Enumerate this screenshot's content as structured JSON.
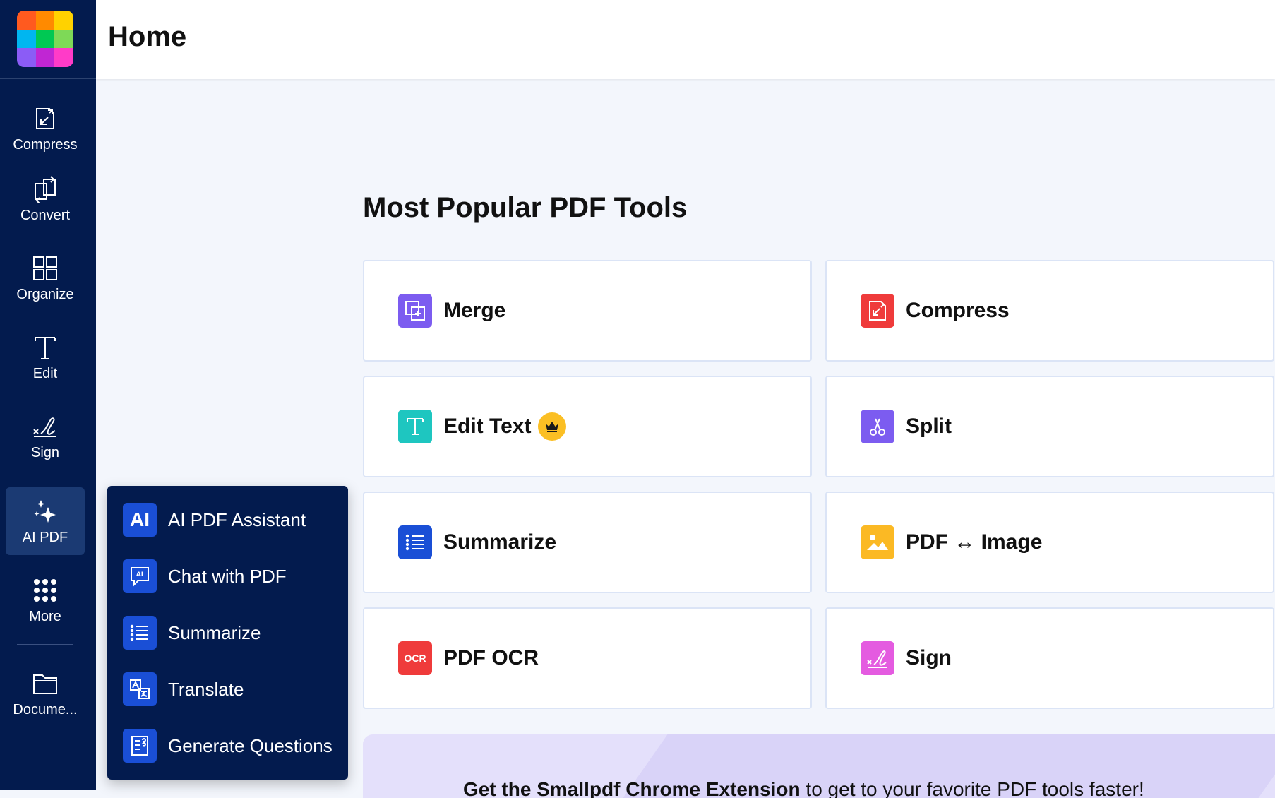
{
  "header": {
    "title": "Home"
  },
  "logo_colors": [
    "#ff5a1f",
    "#ff8a00",
    "#ffd200",
    "#00b6f0",
    "#00c853",
    "#7ed957",
    "#8b5cf6",
    "#c026d3",
    "#ff3bc8"
  ],
  "rail": {
    "items": [
      {
        "label": "Compress",
        "icon": "compress-icon"
      },
      {
        "label": "Convert",
        "icon": "convert-icon"
      },
      {
        "label": "Organize",
        "icon": "organize-icon"
      },
      {
        "label": "Edit",
        "icon": "edit-text-icon"
      },
      {
        "label": "Sign",
        "icon": "sign-icon"
      },
      {
        "label": "AI PDF",
        "icon": "sparkles-icon",
        "active": true
      },
      {
        "label": "More",
        "icon": "grid-dots-icon"
      },
      {
        "label": "Docume...",
        "icon": "folder-icon"
      }
    ]
  },
  "ai_menu": {
    "items": [
      {
        "label": "AI PDF Assistant",
        "icon": "ai-badge-icon",
        "badge": "AI"
      },
      {
        "label": "Chat with PDF",
        "icon": "chat-ai-icon"
      },
      {
        "label": "Summarize",
        "icon": "list-icon"
      },
      {
        "label": "Translate",
        "icon": "translate-icon"
      },
      {
        "label": "Generate Questions",
        "icon": "questions-doc-icon"
      }
    ]
  },
  "main": {
    "section_title": "Most Popular PDF Tools",
    "tools": [
      {
        "label": "Merge",
        "icon": "merge-icon",
        "color": "#7c5cf0"
      },
      {
        "label": "Compress",
        "icon": "compress-icon",
        "color": "#ef3b3b"
      },
      {
        "label": "Edit Text",
        "icon": "edit-text-icon",
        "color": "#1ec6c0",
        "premium": true
      },
      {
        "label": "Split",
        "icon": "scissors-icon",
        "color": "#7c5cf0"
      },
      {
        "label": "Summarize",
        "icon": "list-icon",
        "color": "#1a4fd6"
      },
      {
        "label": "PDF ↔ Image",
        "icon": "image-icon",
        "color": "#fbb924"
      },
      {
        "label": "PDF OCR",
        "icon": "ocr-icon",
        "color": "#ef3b3b",
        "icon_text": "OCR"
      },
      {
        "label": "Sign",
        "icon": "sign-icon",
        "color": "#e45be0"
      }
    ]
  },
  "promo": {
    "bold": "Get the Smallpdf Chrome Extension",
    "rest": " to get to your favorite PDF tools faster!"
  }
}
